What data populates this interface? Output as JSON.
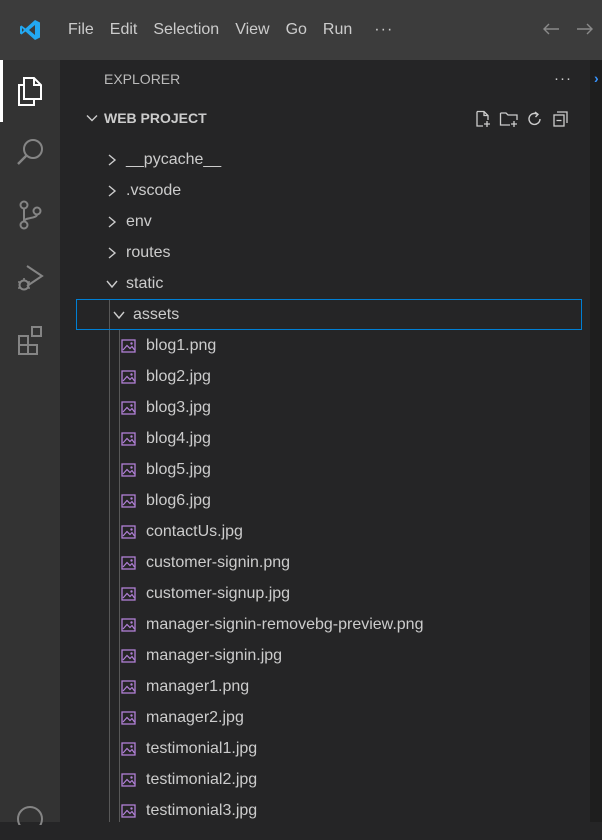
{
  "titlebar": {
    "menu": [
      "File",
      "Edit",
      "Selection",
      "View",
      "Go",
      "Run"
    ],
    "more": "···"
  },
  "activity": {
    "items": [
      {
        "name": "explorer-icon",
        "active": true
      },
      {
        "name": "search-icon",
        "active": false
      },
      {
        "name": "source-control-icon",
        "active": false
      },
      {
        "name": "run-debug-icon",
        "active": false
      },
      {
        "name": "extensions-icon",
        "active": false
      }
    ]
  },
  "explorer": {
    "title": "EXPLORER",
    "more": "···",
    "project_title": "WEB PROJECT"
  },
  "tree": {
    "folders_top": [
      "__pycache__",
      ".vscode",
      "env",
      "routes"
    ],
    "static": "static",
    "assets": "assets",
    "files": [
      "blog1.png",
      "blog2.jpg",
      "blog3.jpg",
      "blog4.jpg",
      "blog5.jpg",
      "blog6.jpg",
      "contactUs.jpg",
      "customer-signin.png",
      "customer-signup.jpg",
      "manager-signin-removebg-preview.png",
      "manager-signin.jpg",
      "manager1.png",
      "manager2.jpg",
      "testimonial1.jpg",
      "testimonial2.jpg",
      "testimonial3.jpg"
    ]
  },
  "colors": {
    "accent": "#007fd4",
    "logo_blue": "#23a9f2",
    "image_icon": "#b180d7"
  }
}
